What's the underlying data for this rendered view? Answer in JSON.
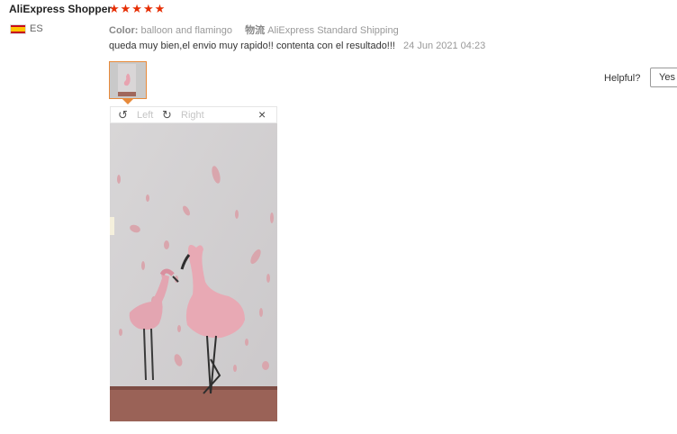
{
  "reviewer": {
    "name": "AliExpress Shopper",
    "stars": "★★★★★",
    "country_code": "ES"
  },
  "attributes": {
    "color_label": "Color:",
    "color_value": "balloon and flamingo",
    "shipping_label": "物流",
    "shipping_value": "AliExpress Standard Shipping"
  },
  "review": {
    "text": "queda muy bien,el envio muy rapido!! contenta con el resultado!!!",
    "date": "24 Jun 2021 04:23"
  },
  "helpful": {
    "label": "Helpful?",
    "yes_label": "Yes"
  },
  "viewer": {
    "left_label": "Left",
    "right_label": "Right",
    "close": "×"
  },
  "icons": {
    "rotate_left": "↺",
    "rotate_right": "↻",
    "flag": "flag-es-icon"
  },
  "colors": {
    "star": "#e62e04",
    "thumb_border": "#e78a3a"
  }
}
